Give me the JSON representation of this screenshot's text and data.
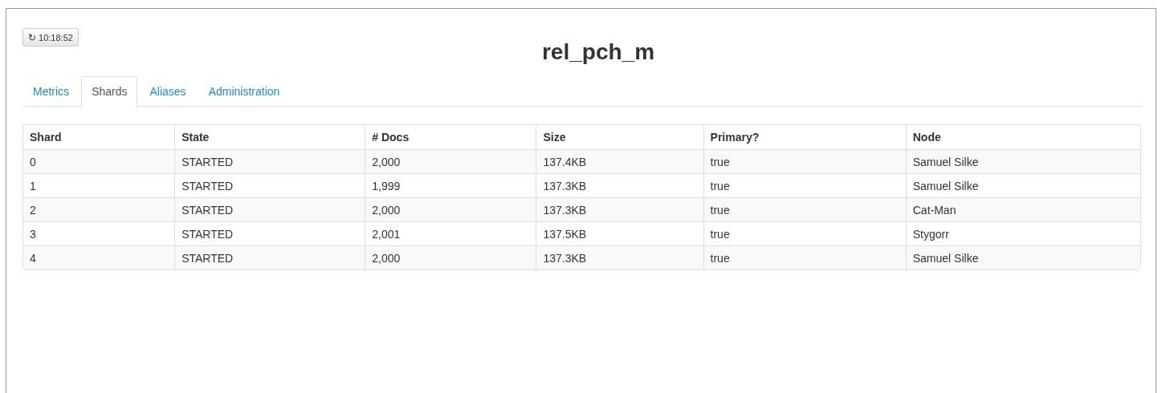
{
  "refresh_button": {
    "icon": "↻",
    "label": "10:18:52"
  },
  "title": "rel_pch_m",
  "tabs": [
    {
      "label": "Metrics",
      "selected": false
    },
    {
      "label": "Shards",
      "selected": true
    },
    {
      "label": "Aliases",
      "selected": false
    },
    {
      "label": "Administration",
      "selected": false
    }
  ],
  "table": {
    "columns": [
      "Shard",
      "State",
      "# Docs",
      "Size",
      "Primary?",
      "Node"
    ],
    "rows": [
      [
        "0",
        "STARTED",
        "2,000",
        "137.4KB",
        "true",
        "Samuel Silke"
      ],
      [
        "1",
        "STARTED",
        "1,999",
        "137.3KB",
        "true",
        "Samuel Silke"
      ],
      [
        "2",
        "STARTED",
        "2,000",
        "137.3KB",
        "true",
        "Cat-Man"
      ],
      [
        "3",
        "STARTED",
        "2,001",
        "137.5KB",
        "true",
        "Stygorr"
      ],
      [
        "4",
        "STARTED",
        "2,000",
        "137.3KB",
        "true",
        "Samuel Silke"
      ]
    ]
  }
}
